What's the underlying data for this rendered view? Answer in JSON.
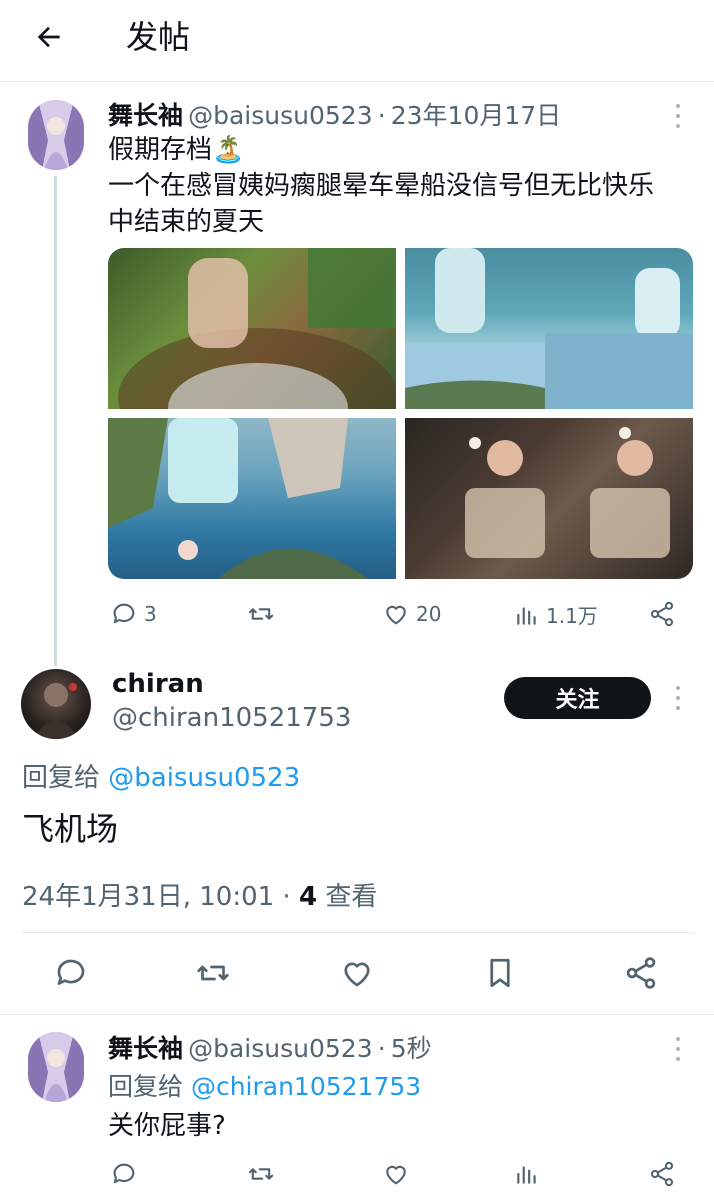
{
  "header": {
    "title": "发帖"
  },
  "original_tweet": {
    "name": "舞长袖",
    "handle": "@baisusu0523",
    "separator": "·",
    "date": "23年10月17日",
    "text_line1": "假期存档🏝️",
    "text_line2": "一个在感冒姨妈瘸腿晕车晕船没信号但无比快乐",
    "text_line3": "中结束的夏天",
    "stats": {
      "replies": "3",
      "likes": "20",
      "views": "1.1万"
    }
  },
  "main_reply": {
    "name": "chiran",
    "handle": "@chiran10521753",
    "follow_label": "关注",
    "reply_to_prefix": "回复给 ",
    "reply_to_handle": "@baisusu0523",
    "text": "飞机场",
    "timestamp": "24年1月31日, 10:01 · ",
    "views_count": "4",
    "views_label": " 查看"
  },
  "second_reply": {
    "name": "舞长袖",
    "handle": "@baisusu0523",
    "separator": "·",
    "time": "5秒",
    "reply_to_prefix": "回复给 ",
    "reply_to_handle": "@chiran10521753",
    "text": "关你屁事?"
  },
  "colors": {
    "link": "#1d9bf0",
    "secondary": "#536471",
    "primary": "#0f1419",
    "follow_bg": "#0f1419"
  },
  "icons": [
    "back-arrow-icon",
    "more-icon",
    "reply-icon",
    "retweet-icon",
    "like-icon",
    "views-icon",
    "share-icon",
    "bookmark-icon"
  ]
}
